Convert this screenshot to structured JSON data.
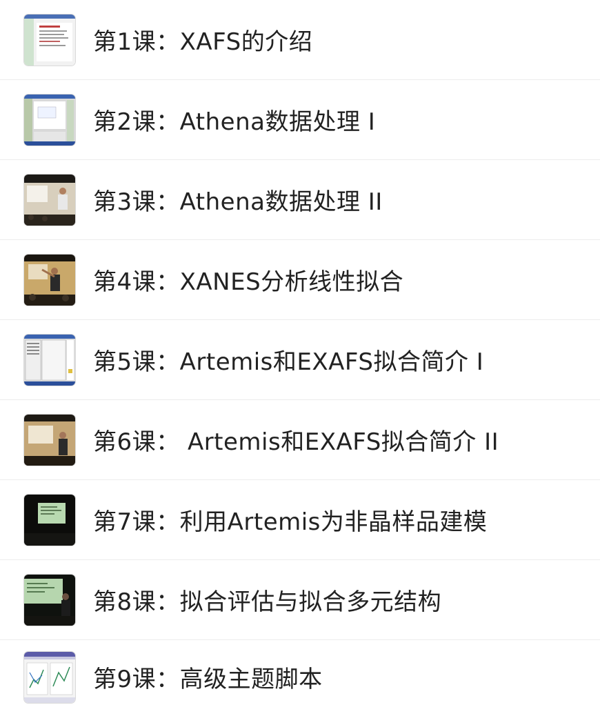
{
  "lessons": [
    {
      "title": "第1课：XAFS的介绍",
      "thumbnail": "slide-screenshot"
    },
    {
      "title": "第2课：Athena数据处理 I",
      "thumbnail": "software-screenshot"
    },
    {
      "title": "第3课：Athena数据处理 II",
      "thumbnail": "lecture-video"
    },
    {
      "title": "第4课：XANES分析线性拟合",
      "thumbnail": "lecture-video"
    },
    {
      "title": "第5课：Artemis和EXAFS拟合简介 I",
      "thumbnail": "software-screenshot"
    },
    {
      "title": "第6课： Artemis和EXAFS拟合简介 II",
      "thumbnail": "lecture-video"
    },
    {
      "title": "第7课：利用Artemis为非晶样品建模",
      "thumbnail": "projector-slide"
    },
    {
      "title": "第8课：拟合评估与拟合多元结构",
      "thumbnail": "lecture-video"
    },
    {
      "title": "第9课：高级主题脚本",
      "thumbnail": "plot-screenshot"
    }
  ]
}
